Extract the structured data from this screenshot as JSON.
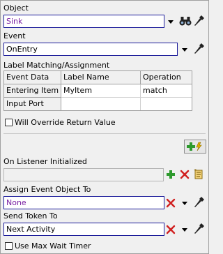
{
  "object": {
    "label": "Object",
    "value": "Sink"
  },
  "event": {
    "label": "Event",
    "value": "OnEntry"
  },
  "label_matching": {
    "title": "Label Matching/Assignment",
    "columns": [
      "Event Data",
      "Label Name",
      "Operation"
    ],
    "rows": [
      {
        "event_data": "Entering Item",
        "label_name": "MyItem",
        "operation": "match"
      },
      {
        "event_data": "Input Port",
        "label_name": "",
        "operation": ""
      }
    ]
  },
  "will_override": {
    "label": "Will Override Return Value",
    "checked": false
  },
  "on_listener": {
    "label": "On Listener Initialized",
    "value": ""
  },
  "assign_event_object": {
    "label": "Assign Event Object To",
    "value": "None"
  },
  "send_token": {
    "label": "Send Token To",
    "value": "Next Activity"
  },
  "use_max_wait": {
    "label": "Use Max Wait Timer",
    "checked": false
  },
  "colors": {
    "field_border": "#1b1b9a",
    "purple_text": "#7a1fa2",
    "add_green": "#2e9a2e",
    "delete_red": "#d01f1f"
  }
}
